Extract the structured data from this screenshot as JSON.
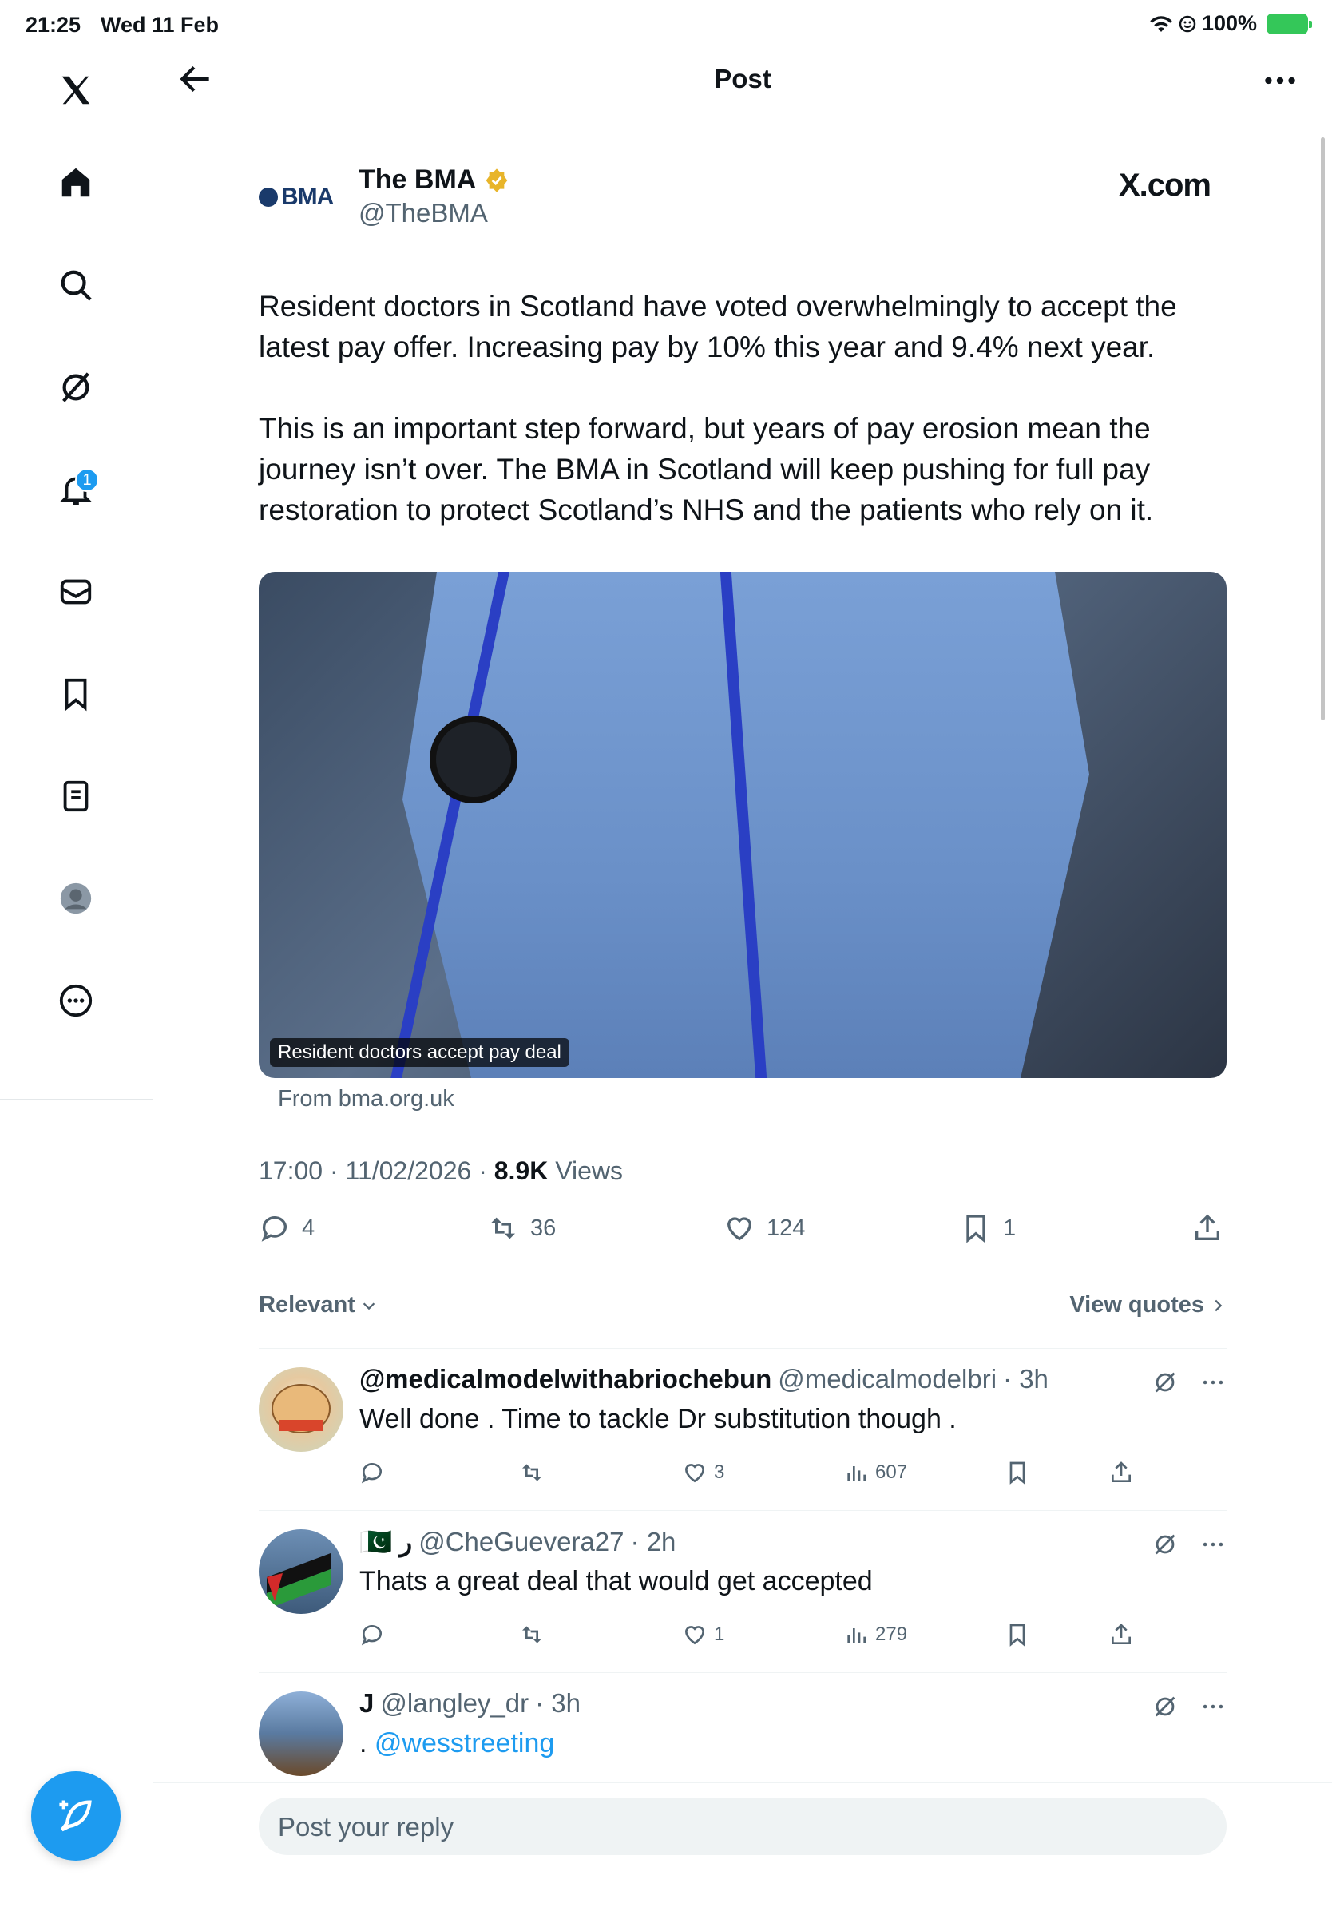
{
  "status_bar": {
    "time": "21:25",
    "date": "Wed 11 Feb",
    "battery": "100%"
  },
  "sidebar": {
    "notification_badge": "1",
    "items": [
      "X",
      "Home",
      "Explore",
      "Grok",
      "Notifications",
      "Messages",
      "Bookmarks",
      "Lists",
      "Profile",
      "More"
    ]
  },
  "header": {
    "title": "Post"
  },
  "post": {
    "author_logo": "BMA",
    "author_name": "The BMA",
    "author_handle": "@TheBMA",
    "site": "X.com",
    "paragraph1": "Resident doctors in Scotland have voted overwhelmingly to accept the latest pay offer. Increasing pay by 10% this year and 9.4% next year.",
    "paragraph2": "This is an important step forward, but years of pay erosion mean the journey isn’t over. The BMA in Scotland will keep pushing for full pay restoration to protect Scotland’s NHS and the patients who rely on it.",
    "media_caption": "Resident doctors accept pay deal",
    "media_source": "From bma.org.uk",
    "time": "17:00 · 11/02/2026 · ",
    "views_count": "8.9K",
    "views_label": " Views",
    "replies": "4",
    "reposts": "36",
    "likes": "124",
    "bookmarks": "1"
  },
  "replies_header": {
    "sort_label": "Relevant",
    "view_quotes": "View quotes"
  },
  "replies": [
    {
      "name": "@medicalmodelwithabriochebun",
      "handle": "@medicalmodelbri",
      "time": "· 3h",
      "text": "Well done . Time to tackle Dr substitution though .",
      "likes": "3",
      "views": "607"
    },
    {
      "name": "🇵🇰 ر",
      "handle": "@CheGuevera27",
      "time": "· 2h",
      "text": "Thats a great deal that would get accepted",
      "likes": "1",
      "views": "279"
    },
    {
      "name": "J",
      "handle": "@langley_dr",
      "time": "· 3h",
      "text_prefix": ". ",
      "mention": "@wesstreeting"
    }
  ],
  "composer": {
    "placeholder": "Post your reply"
  },
  "colors": {
    "accent": "#1d9bf0",
    "verified_badge": "#e8b52a",
    "text_secondary": "#536471"
  }
}
